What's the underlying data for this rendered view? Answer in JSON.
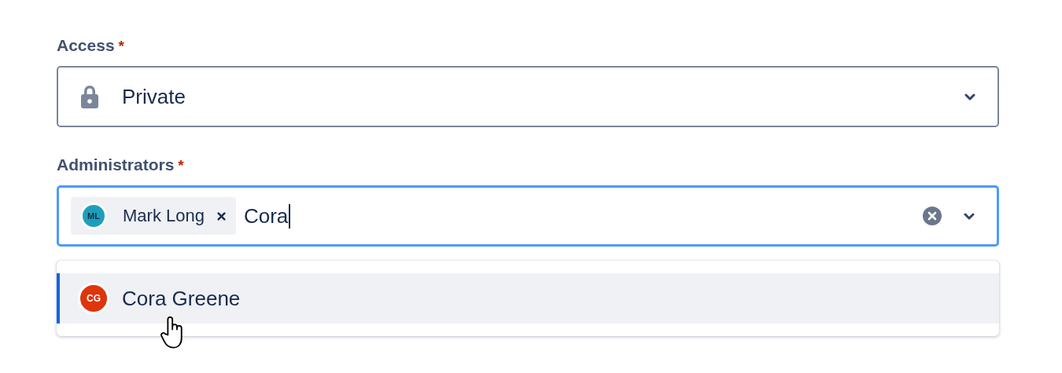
{
  "access": {
    "label": "Access",
    "required_mark": "*",
    "value": "Private"
  },
  "administrators": {
    "label": "Administrators",
    "required_mark": "*",
    "focused": true,
    "tags": [
      {
        "initials": "ML",
        "name": "Mark Long",
        "color": "#1d9fbb"
      }
    ],
    "input_value": "Cora",
    "options": [
      {
        "initials": "CG",
        "name": "Cora Greene",
        "color": "#de350b",
        "selected": true
      }
    ]
  }
}
